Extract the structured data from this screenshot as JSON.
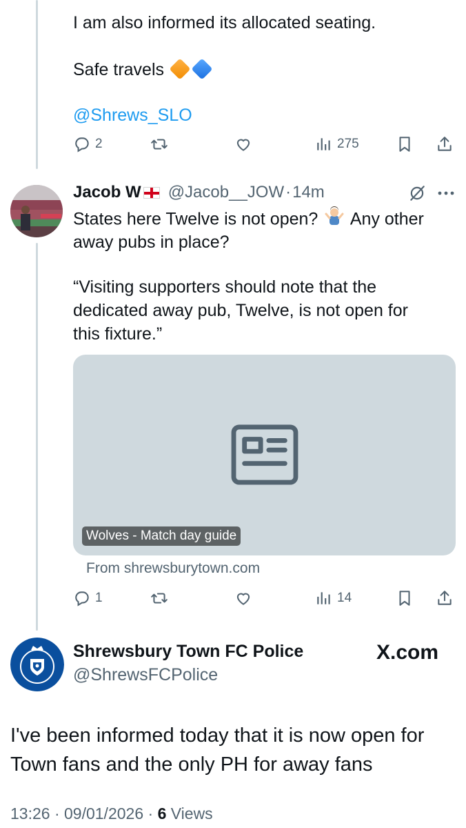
{
  "tweet1": {
    "line1": "I am also informed its allocated seating.",
    "line2": "Safe travels",
    "emoji1": "orange-diamond-emoji",
    "emoji2": "blue-diamond-emoji",
    "mention": "@Shrews_SLO",
    "replies": "2",
    "views": "275"
  },
  "tweet2": {
    "display_name": "Jacob W",
    "flag": "england-flag-emoji",
    "handle": "@Jacob__JOW",
    "sep": "·",
    "time": "14m",
    "text_line1": "States here Twelve is not open?",
    "shrug_emoji": "person-shrugging-emoji",
    "text_line1b": "Any other",
    "text_line2": "away pubs in place?",
    "quote_line1": "“Visiting supporters should note that the",
    "quote_line2": "dedicated away pub, Twelve, is not open for",
    "quote_line3": "this fixture.”",
    "card_title": "Wolves - Match day guide",
    "card_source": "From shrewsburytown.com",
    "replies": "1",
    "views": "14"
  },
  "quoted": {
    "name": "Shrewsbury Town FC Police",
    "handle": "@ShrewsFCPolice",
    "logo_text": "X.com",
    "body_line1": "I've been informed today that it is now open for",
    "body_line2": "Town fans and the only PH for away fans",
    "meta_time": "13:26 · 09/01/2026 · ",
    "meta_views_count": "6",
    "meta_views_label": " Views"
  },
  "colors": {
    "text": "#0f1419",
    "secondary": "#536471",
    "link": "#1d9bf0",
    "thread_line": "#cfd9de",
    "card_bg": "#cfd9de",
    "police_blue": "#0a4f9e"
  }
}
